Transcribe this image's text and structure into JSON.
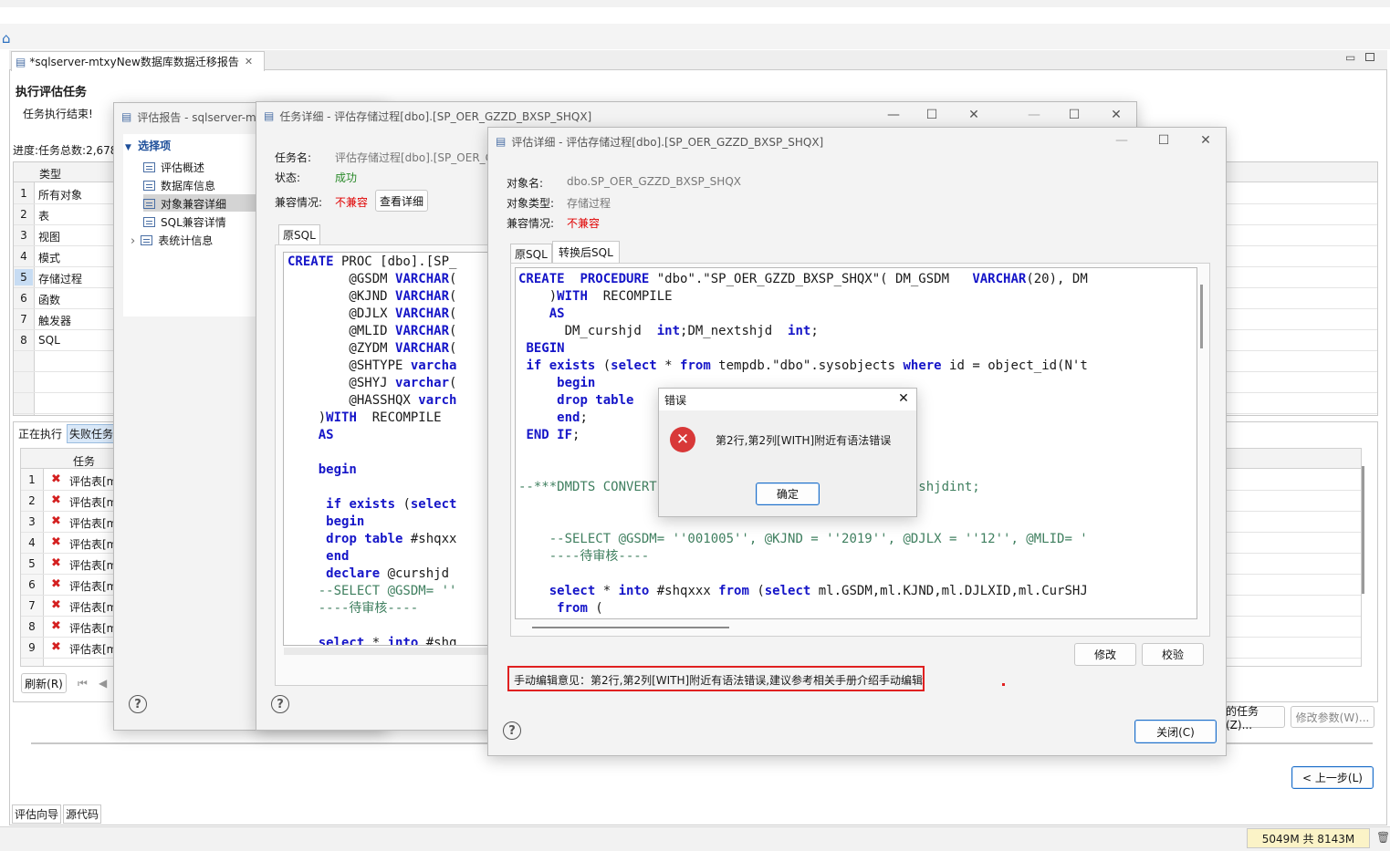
{
  "main": {
    "editor_tab_title": "*sqlserver-mtxyNew数据库数据迁移报告",
    "section_title": "执行评估任务",
    "status_message": "任务执行结束!",
    "progress_label": "进度:任务总数:2,678",
    "type_header": "类型",
    "types": [
      {
        "n": "1",
        "label": "所有对象"
      },
      {
        "n": "2",
        "label": "表"
      },
      {
        "n": "3",
        "label": "视图"
      },
      {
        "n": "4",
        "label": "模式"
      },
      {
        "n": "5",
        "label": "存储过程"
      },
      {
        "n": "6",
        "label": "函数"
      },
      {
        "n": "7",
        "label": "触发器"
      },
      {
        "n": "8",
        "label": "SQL"
      }
    ],
    "task_tabs": [
      "正在执行",
      "失败任务"
    ],
    "task_header": "任务",
    "task_rows": [
      {
        "n": "1",
        "label": "评估表[m"
      },
      {
        "n": "2",
        "label": "评估表[m"
      },
      {
        "n": "3",
        "label": "评估表[m"
      },
      {
        "n": "4",
        "label": "评估表[m"
      },
      {
        "n": "5",
        "label": "评估表[m"
      },
      {
        "n": "6",
        "label": "评估表[m"
      },
      {
        "n": "7",
        "label": "评估表[m"
      },
      {
        "n": "8",
        "label": "评估表[m"
      },
      {
        "n": "9",
        "label": "评估表[m"
      }
    ],
    "refresh_label": "刷新(R)",
    "tasks_btn": "的任务(Z)...",
    "modify_params_btn": "修改参数(W)...",
    "prev_btn": "< 上一步(L)",
    "bottom_tabs": [
      "评估向导",
      "源代码"
    ],
    "memory": "5049M 共 8143M"
  },
  "report_win": {
    "title": "评估报告 - sqlserver-mt",
    "tree_root": "选择项",
    "tree_items": [
      "评估概述",
      "数据库信息",
      "对象兼容详细",
      "SQL兼容详情",
      "表统计信息"
    ]
  },
  "task_win": {
    "title": "任务详细 - 评估存储过程[dbo].[SP_OER_GZZD_BXSP_SHQX]",
    "name_label": "任务名:",
    "name_value": "评估存储过程[dbo].[SP_OER_G",
    "state_label": "状态:",
    "state_value": "成功",
    "compat_label": "兼容情况:",
    "compat_value": "不兼容",
    "detail_btn": "查看详细",
    "tab": "原SQL"
  },
  "eval_win": {
    "title": "评估详细 - 评估存储过程[dbo].[SP_OER_GZZD_BXSP_SHQX]",
    "obj_name_label": "对象名:",
    "obj_name_value": "dbo.SP_OER_GZZD_BXSP_SHQX",
    "obj_type_label": "对象类型:",
    "obj_type_value": "存储过程",
    "compat_label": "兼容情况:",
    "compat_value": "不兼容",
    "tabs": [
      "原SQL",
      "转换后SQL"
    ],
    "modify_btn": "修改",
    "verify_btn": "校验",
    "manual_note": "手动编辑意见：第2行,第2列[WITH]附近有语法错误,建议参考相关手册介绍手动编辑",
    "close_btn": "关闭(C)"
  },
  "error_dialog": {
    "title": "错误",
    "message": "第2行,第2列[WITH]附近有语法错误",
    "ok_btn": "确定"
  },
  "colors": {
    "keyword": "#1515c8",
    "comment": "#3f7f5f",
    "error_red": "#e00000",
    "success_green": "#2a8a2a",
    "highlight_box": "#e02020"
  }
}
